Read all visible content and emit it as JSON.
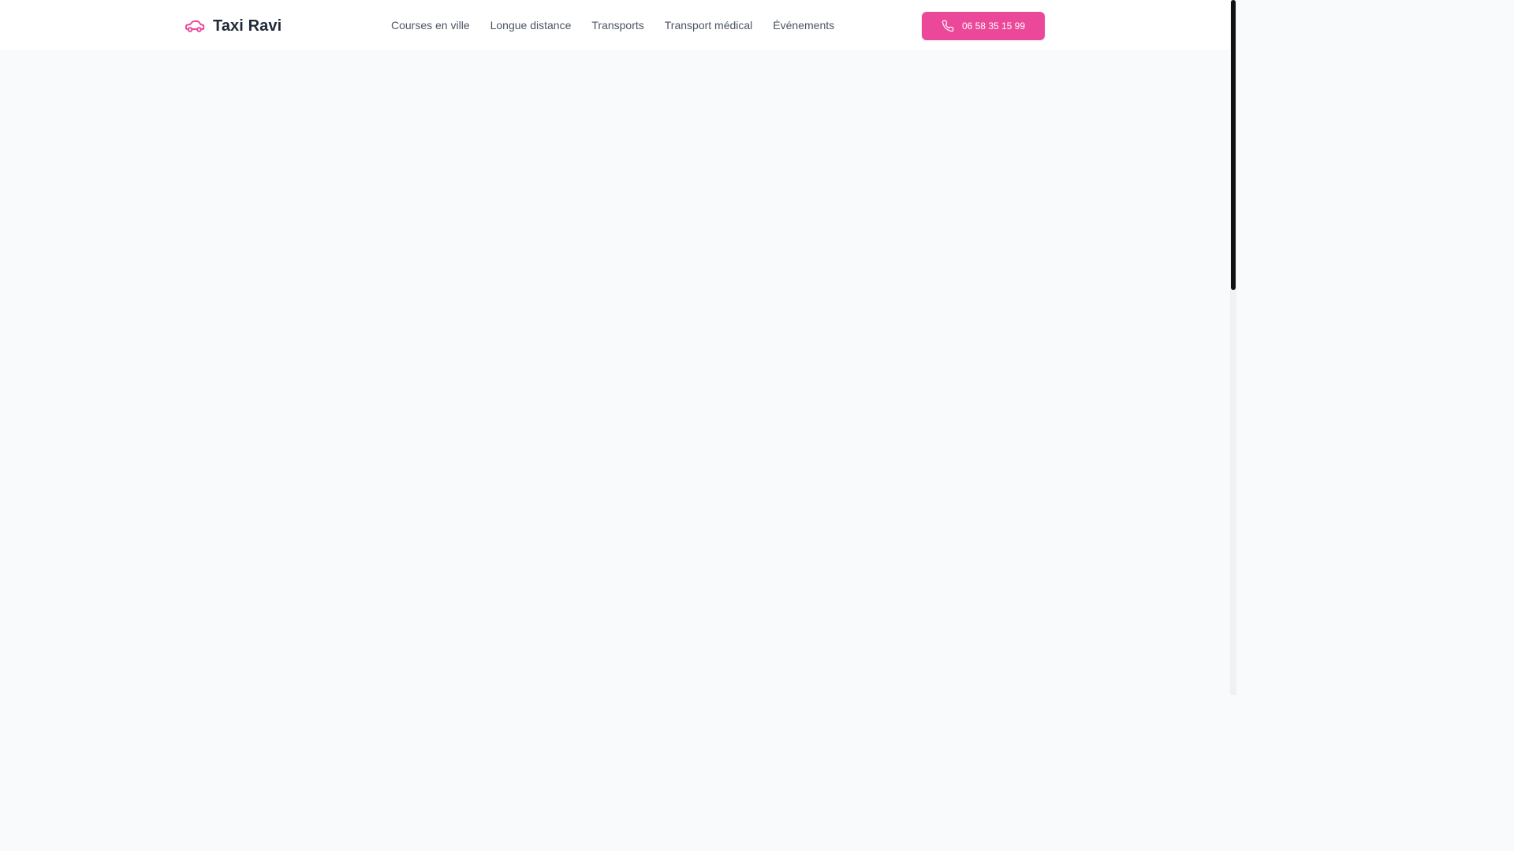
{
  "header": {
    "brand": {
      "name": "Taxi Ravi",
      "icon": "car-icon"
    },
    "nav": {
      "items": [
        {
          "label": "Courses en ville"
        },
        {
          "label": "Longue distance"
        },
        {
          "label": "Transports"
        },
        {
          "label": "Transport médical"
        },
        {
          "label": "Événements"
        }
      ]
    },
    "call_button": {
      "label": "06 58 35 15 99",
      "icon": "phone-icon"
    }
  },
  "colors": {
    "accent": "#ec4899",
    "brand_text": "#1f2937",
    "nav_text": "#4b5563",
    "page_background": "#f9fafb",
    "header_background": "#ffffff"
  }
}
